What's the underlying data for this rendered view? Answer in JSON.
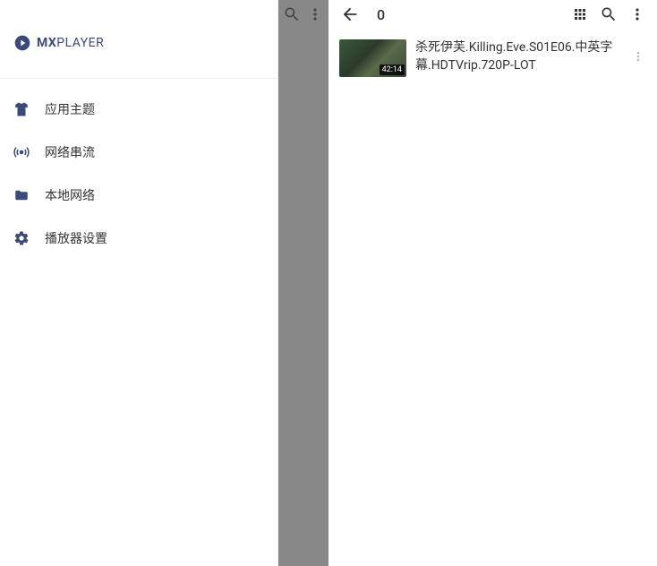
{
  "brand": {
    "prefix": "MX",
    "suffix": "PLAYER",
    "color": "#3b4a7a"
  },
  "drawer": {
    "items": [
      {
        "label": "应用主题",
        "icon": "shirt-icon"
      },
      {
        "label": "网络串流",
        "icon": "stream-icon"
      },
      {
        "label": "本地网络",
        "icon": "folder-icon"
      },
      {
        "label": "播放器设置",
        "icon": "gear-icon"
      }
    ]
  },
  "folder": {
    "title": "0"
  },
  "videos": [
    {
      "title": "杀死伊芙.Killing.Eve.S01E06.中英字幕.HDTVrip.720P-LOT",
      "duration": "42:14"
    }
  ]
}
